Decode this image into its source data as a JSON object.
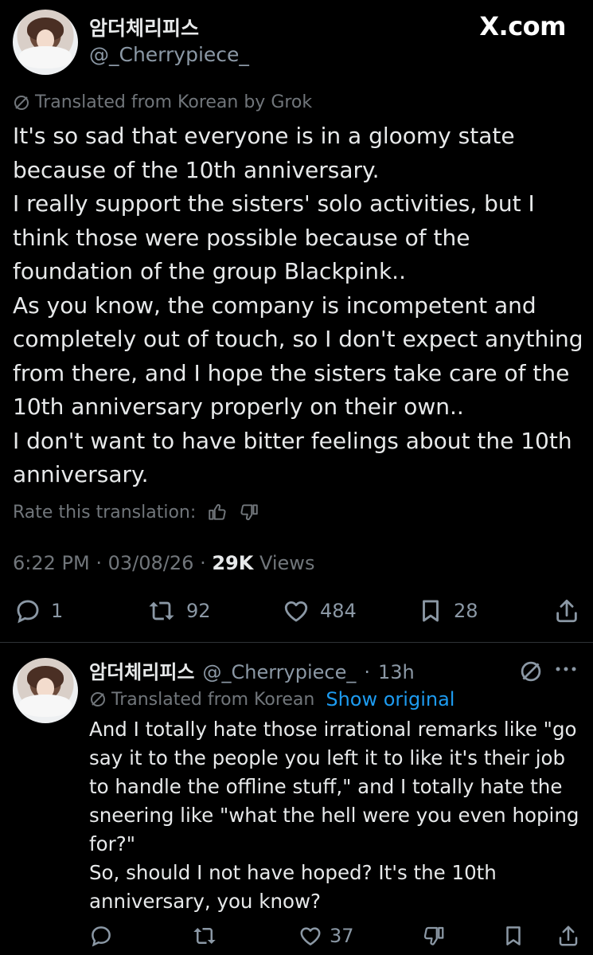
{
  "site_label": "X.com",
  "tweet": {
    "author_name": "암더체리피스",
    "author_handle": "@_Cherrypiece_",
    "translation_label": "Translated from Korean by Grok",
    "text_lines": [
      "It's so sad that everyone is in a gloomy state",
      "because of the 10th anniversary.",
      "I really support the sisters' solo activities, but I",
      "think those were possible because of the",
      "foundation of the group Blackpink..",
      "As you know, the company is incompetent and",
      "completely out of touch, so I don't expect anything",
      "from there, and I hope the sisters take care of the",
      "10th anniversary properly on their own..",
      "I don't want to have bitter feelings about the 10th",
      "anniversary."
    ],
    "rate_label": "Rate this translation:",
    "time": "6:22 PM",
    "date": "03/08/26",
    "views_count": "29K",
    "views_label": "Views",
    "separator": "·",
    "actions": {
      "replies": "1",
      "reposts": "92",
      "likes": "484",
      "bookmarks": "28"
    }
  },
  "reply": {
    "author_name": "암더체리피스",
    "author_handle": "@_Cherrypiece_",
    "time_ago": "13h",
    "translation_label": "Translated from Korean",
    "show_original_label": "Show original",
    "text_lines": [
      "And I totally hate those irrational remarks like \"go",
      "say it to the people you left it to like it's their job",
      "to handle the offline stuff,\" and I totally hate the",
      "sneering like \"what the hell were you even hoping",
      "for?\"",
      "So, should I not have hoped? It's the 10th",
      "anniversary, you know?"
    ],
    "actions": {
      "likes": "37"
    }
  },
  "colors": {
    "background": "#000000",
    "text": "#e7e9ea",
    "muted": "#71767b",
    "link": "#1d9bf0",
    "divider": "#2f3336"
  }
}
